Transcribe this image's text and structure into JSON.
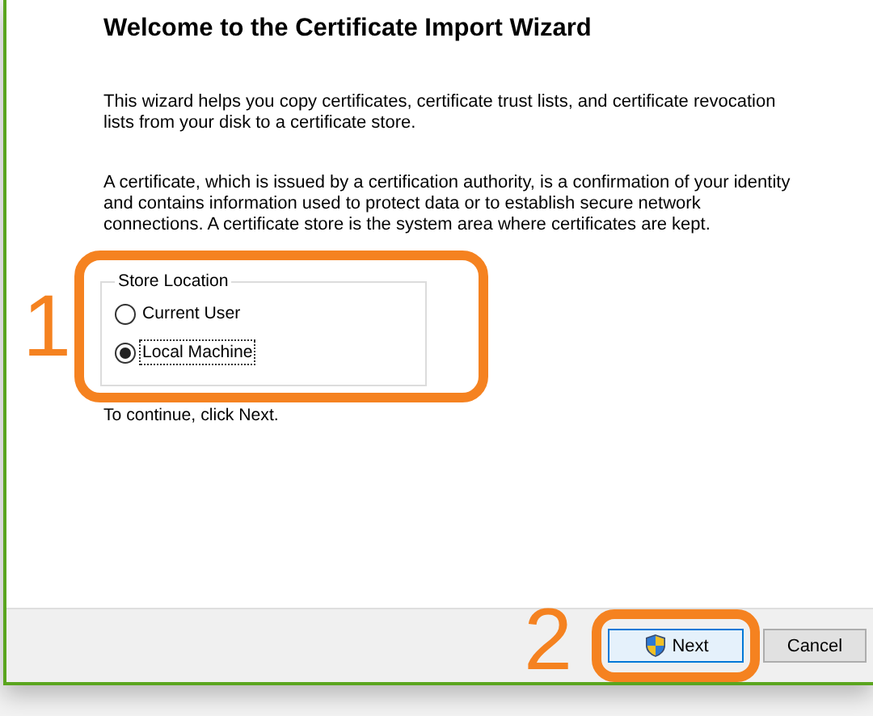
{
  "wizard": {
    "title": "Welcome to the Certificate Import Wizard",
    "paragraphs": [
      "This wizard helps you copy certificates, certificate trust lists, and certificate revocation lists from your disk to a certificate store.",
      "A certificate, which is issued by a certification authority, is a confirmation of your identity and contains information used to protect data or to establish secure network connections. A certificate store is the system area where certificates are kept."
    ],
    "store_location": {
      "legend": "Store Location",
      "options": [
        {
          "label": "Current User",
          "selected": false
        },
        {
          "label": "Local Machine",
          "selected": true
        }
      ]
    },
    "hint": "To continue, click Next.",
    "buttons": [
      {
        "label": "Next",
        "kind": "elevated",
        "default": true
      },
      {
        "label": "Cancel",
        "kind": "plain",
        "default": false
      }
    ]
  },
  "annotations": [
    {
      "label": "1"
    },
    {
      "label": "2"
    }
  ]
}
